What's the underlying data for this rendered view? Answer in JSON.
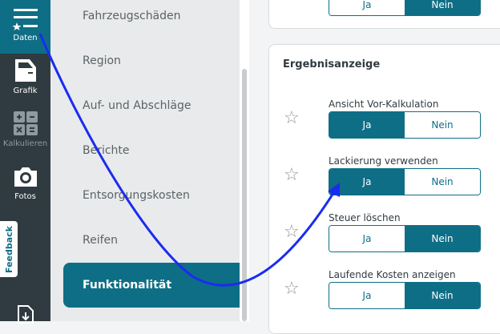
{
  "rail": {
    "items": [
      {
        "label": "Daten",
        "icon": "menu-list-icon"
      },
      {
        "label": "Grafik",
        "icon": "car-door-icon"
      },
      {
        "label": "Kalkulieren",
        "icon": "calculator-icon"
      },
      {
        "label": "Fotos",
        "icon": "camera-icon"
      }
    ],
    "feedback_label": "Feedback"
  },
  "menu": {
    "items": [
      {
        "label": "Fahrzeugschäden"
      },
      {
        "label": "Region"
      },
      {
        "label": "Auf- und Abschläge"
      },
      {
        "label": "Berichte"
      },
      {
        "label": "Entsorgungskosten"
      },
      {
        "label": "Reifen"
      },
      {
        "label": "Funktionalität"
      }
    ]
  },
  "content": {
    "top_toggle": {
      "yes": "Ja",
      "no": "Nein",
      "selected": "Nein"
    },
    "section_title": "Ergebnisanzeige",
    "rows": [
      {
        "label": "Ansicht Vor-Kalkulation",
        "yes": "Ja",
        "no": "Nein",
        "selected": "Ja"
      },
      {
        "label": "Lackierung verwenden",
        "yes": "Ja",
        "no": "Nein",
        "selected": "Ja"
      },
      {
        "label": "Steuer löschen",
        "yes": "Ja",
        "no": "Nein",
        "selected": "Nein"
      },
      {
        "label": "Laufende Kosten anzeigen",
        "yes": "Ja",
        "no": "Nein",
        "selected": "Nein"
      }
    ]
  },
  "colors": {
    "accent": "#0e6e86",
    "rail": "#2f3b40",
    "arrow": "#1a2cf0"
  }
}
